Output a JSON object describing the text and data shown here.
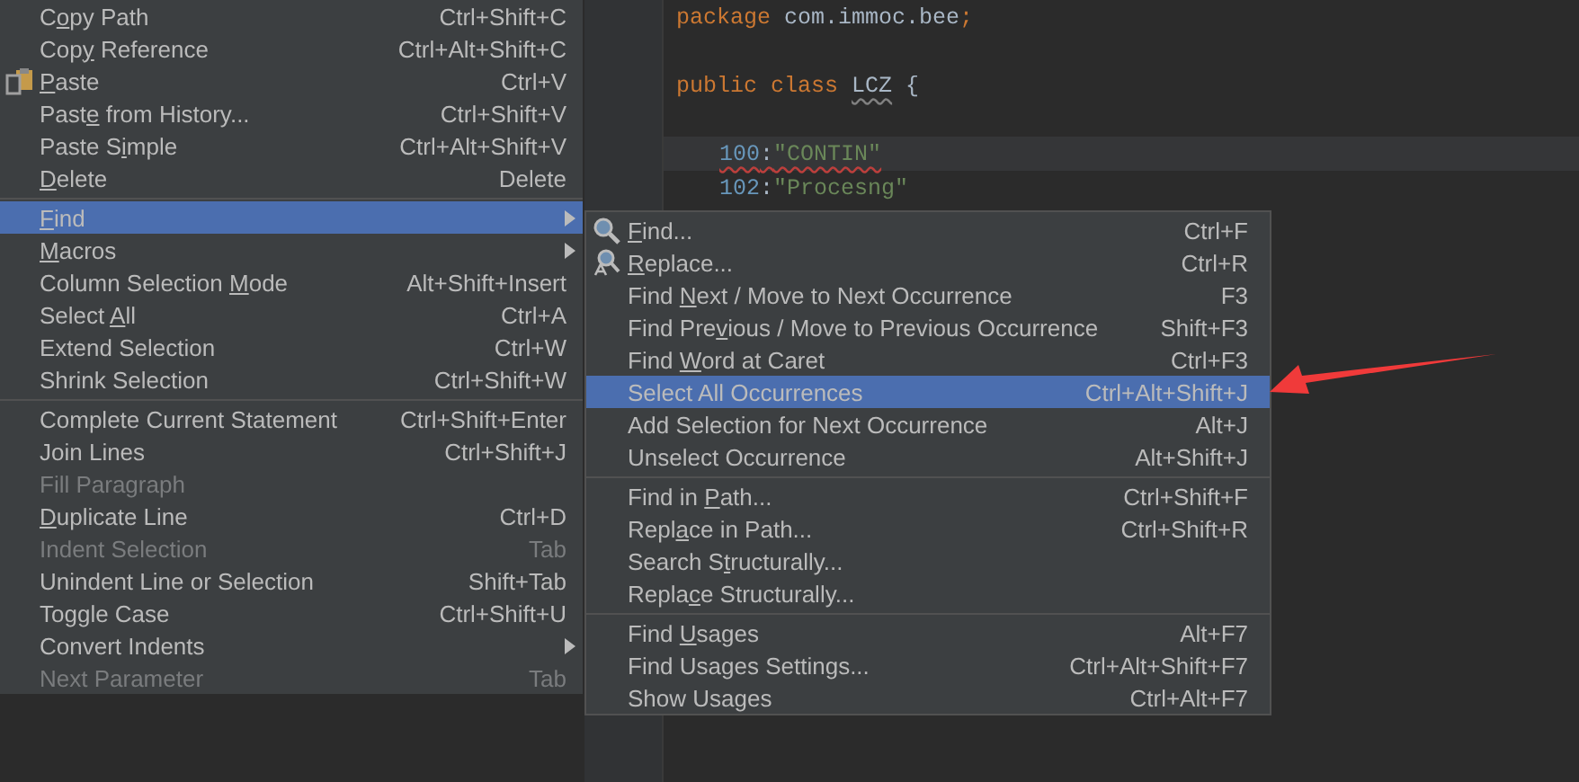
{
  "editor": {
    "lines": [
      {
        "current": false,
        "indented": false,
        "tokens": [
          {
            "kind": "keyword",
            "text": "package"
          },
          {
            "kind": "plain",
            "text": " com.immoc.bee"
          },
          {
            "kind": "keyword",
            "text": ";"
          }
        ]
      },
      {
        "current": false,
        "indented": false,
        "gap_before": true,
        "tokens": [
          {
            "kind": "keyword",
            "text": "public class "
          },
          {
            "kind": "plain",
            "text": "LCZ",
            "typo": true
          },
          {
            "kind": "plain",
            "text": " {"
          }
        ]
      },
      {
        "current": true,
        "indented": true,
        "gap_before": true,
        "tokens": [
          {
            "kind": "number",
            "text": "100",
            "error": true
          },
          {
            "kind": "plain",
            "text": ":",
            "error": true
          },
          {
            "kind": "string",
            "text": "\"CONTIN\"",
            "error": true
          }
        ]
      },
      {
        "current": false,
        "indented": true,
        "tokens": [
          {
            "kind": "number",
            "text": "102"
          },
          {
            "kind": "plain",
            "text": ":"
          },
          {
            "kind": "string",
            "text": "\"Procesng\""
          }
        ]
      }
    ]
  },
  "edit_menu": {
    "items": [
      {
        "kind": "item",
        "label": {
          "pre": "C",
          "key": "o",
          "post": "py Path"
        },
        "shortcut": "Ctrl+Shift+C",
        "selected": false,
        "disabled": false,
        "submenu": false
      },
      {
        "kind": "item",
        "label": {
          "pre": "Cop",
          "key": "y",
          "post": " Reference"
        },
        "shortcut": "Ctrl+Alt+Shift+C",
        "selected": false,
        "disabled": false,
        "submenu": false
      },
      {
        "kind": "item",
        "label": {
          "key": "P",
          "post": "aste"
        },
        "shortcut": "Ctrl+V",
        "selected": false,
        "disabled": false,
        "submenu": false
      },
      {
        "kind": "item",
        "label": {
          "pre": "Past",
          "key": "e",
          "post": " from History..."
        },
        "shortcut": "Ctrl+Shift+V",
        "selected": false,
        "disabled": false,
        "submenu": false
      },
      {
        "kind": "item",
        "label": {
          "pre": "Paste S",
          "key": "i",
          "post": "mple"
        },
        "shortcut": "Ctrl+Alt+Shift+V",
        "selected": false,
        "disabled": false,
        "submenu": false
      },
      {
        "kind": "item",
        "label": {
          "key": "D",
          "post": "elete"
        },
        "shortcut": "Delete",
        "selected": false,
        "disabled": false,
        "submenu": false
      },
      {
        "kind": "separator"
      },
      {
        "kind": "item",
        "label": {
          "key": "F",
          "post": "ind"
        },
        "selected": true,
        "disabled": false,
        "submenu": true
      },
      {
        "kind": "item",
        "label": {
          "key": "M",
          "post": "acros"
        },
        "selected": false,
        "disabled": false,
        "submenu": true
      },
      {
        "kind": "item",
        "label": {
          "pre": "Column Selection ",
          "key": "M",
          "post": "ode"
        },
        "shortcut": "Alt+Shift+Insert",
        "selected": false,
        "disabled": false,
        "submenu": false
      },
      {
        "kind": "item",
        "label": {
          "pre": "Select ",
          "key": "A",
          "post": "ll"
        },
        "shortcut": "Ctrl+A",
        "selected": false,
        "disabled": false,
        "submenu": false
      },
      {
        "kind": "item",
        "label": {
          "pre": "Extend Selection"
        },
        "shortcut": "Ctrl+W",
        "selected": false,
        "disabled": false,
        "submenu": false
      },
      {
        "kind": "item",
        "label": {
          "pre": "Shrink Selection"
        },
        "shortcut": "Ctrl+Shift+W",
        "selected": false,
        "disabled": false,
        "submenu": false
      },
      {
        "kind": "separator"
      },
      {
        "kind": "item",
        "label": {
          "pre": "Complete Current Statement"
        },
        "shortcut": "Ctrl+Shift+Enter",
        "selected": false,
        "disabled": false,
        "submenu": false
      },
      {
        "kind": "item",
        "label": {
          "pre": "Join Lines"
        },
        "shortcut": "Ctrl+Shift+J",
        "selected": false,
        "disabled": false,
        "submenu": false
      },
      {
        "kind": "item",
        "label": {
          "pre": "Fill Paragraph"
        },
        "selected": false,
        "disabled": true,
        "submenu": false
      },
      {
        "kind": "item",
        "label": {
          "key": "D",
          "post": "uplicate Line"
        },
        "shortcut": "Ctrl+D",
        "selected": false,
        "disabled": false,
        "submenu": false
      },
      {
        "kind": "item",
        "label": {
          "pre": "Indent Selection"
        },
        "shortcut": "Tab",
        "selected": false,
        "disabled": true,
        "submenu": false
      },
      {
        "kind": "item",
        "label": {
          "pre": "Unindent Line or Selection"
        },
        "shortcut": "Shift+Tab",
        "selected": false,
        "disabled": false,
        "submenu": false
      },
      {
        "kind": "item",
        "label": {
          "pre": "Toggle Case"
        },
        "shortcut": "Ctrl+Shift+U",
        "selected": false,
        "disabled": false,
        "submenu": false
      },
      {
        "kind": "item",
        "label": {
          "pre": "Convert Indents"
        },
        "selected": false,
        "disabled": false,
        "submenu": true
      },
      {
        "kind": "item",
        "label": {
          "pre": "Next Parameter"
        },
        "shortcut": "Tab",
        "selected": false,
        "disabled": true,
        "submenu": false
      }
    ]
  },
  "find_submenu": {
    "items": [
      {
        "kind": "item",
        "label": {
          "key": "F",
          "post": "ind..."
        },
        "shortcut": "Ctrl+F",
        "selected": false
      },
      {
        "kind": "item",
        "label": {
          "key": "R",
          "post": "eplace..."
        },
        "shortcut": "Ctrl+R",
        "selected": false
      },
      {
        "kind": "item",
        "label": {
          "pre": "Find ",
          "key": "N",
          "post": "ext / Move to Next Occurrence"
        },
        "shortcut": "F3",
        "selected": false
      },
      {
        "kind": "item",
        "label": {
          "pre": "Find Pre",
          "key": "v",
          "post": "ious / Move to Previous Occurrence"
        },
        "shortcut": "Shift+F3",
        "selected": false
      },
      {
        "kind": "item",
        "label": {
          "pre": "Find ",
          "key": "W",
          "post": "ord at Caret"
        },
        "shortcut": "Ctrl+F3",
        "selected": false
      },
      {
        "kind": "item",
        "label": {
          "pre": "Select All Occurrences"
        },
        "shortcut": "Ctrl+Alt+Shift+J",
        "selected": true
      },
      {
        "kind": "item",
        "label": {
          "pre": "Add Selection for Next Occurrence"
        },
        "shortcut": "Alt+J",
        "selected": false
      },
      {
        "kind": "item",
        "label": {
          "pre": "Unselect Occurrence"
        },
        "shortcut": "Alt+Shift+J",
        "selected": false
      },
      {
        "kind": "separator"
      },
      {
        "kind": "item",
        "label": {
          "pre": "Find in ",
          "key": "P",
          "post": "ath..."
        },
        "shortcut": "Ctrl+Shift+F",
        "selected": false
      },
      {
        "kind": "item",
        "label": {
          "pre": "Repl",
          "key": "a",
          "post": "ce in Path..."
        },
        "shortcut": "Ctrl+Shift+R",
        "selected": false
      },
      {
        "kind": "item",
        "label": {
          "pre": "Search S",
          "key": "t",
          "post": "ructurally..."
        },
        "selected": false
      },
      {
        "kind": "item",
        "label": {
          "pre": "Repla",
          "key": "c",
          "post": "e Structurally..."
        },
        "selected": false
      },
      {
        "kind": "separator"
      },
      {
        "kind": "item",
        "label": {
          "pre": "Find ",
          "key": "U",
          "post": "sages"
        },
        "shortcut": "Alt+F7",
        "selected": false
      },
      {
        "kind": "item",
        "label": {
          "pre": "Find Usages Settings..."
        },
        "shortcut": "Ctrl+Alt+Shift+F7",
        "selected": false
      },
      {
        "kind": "item",
        "label": {
          "pre": "Show Usages"
        },
        "shortcut": "Ctrl+Alt+F7",
        "selected": false
      }
    ]
  }
}
